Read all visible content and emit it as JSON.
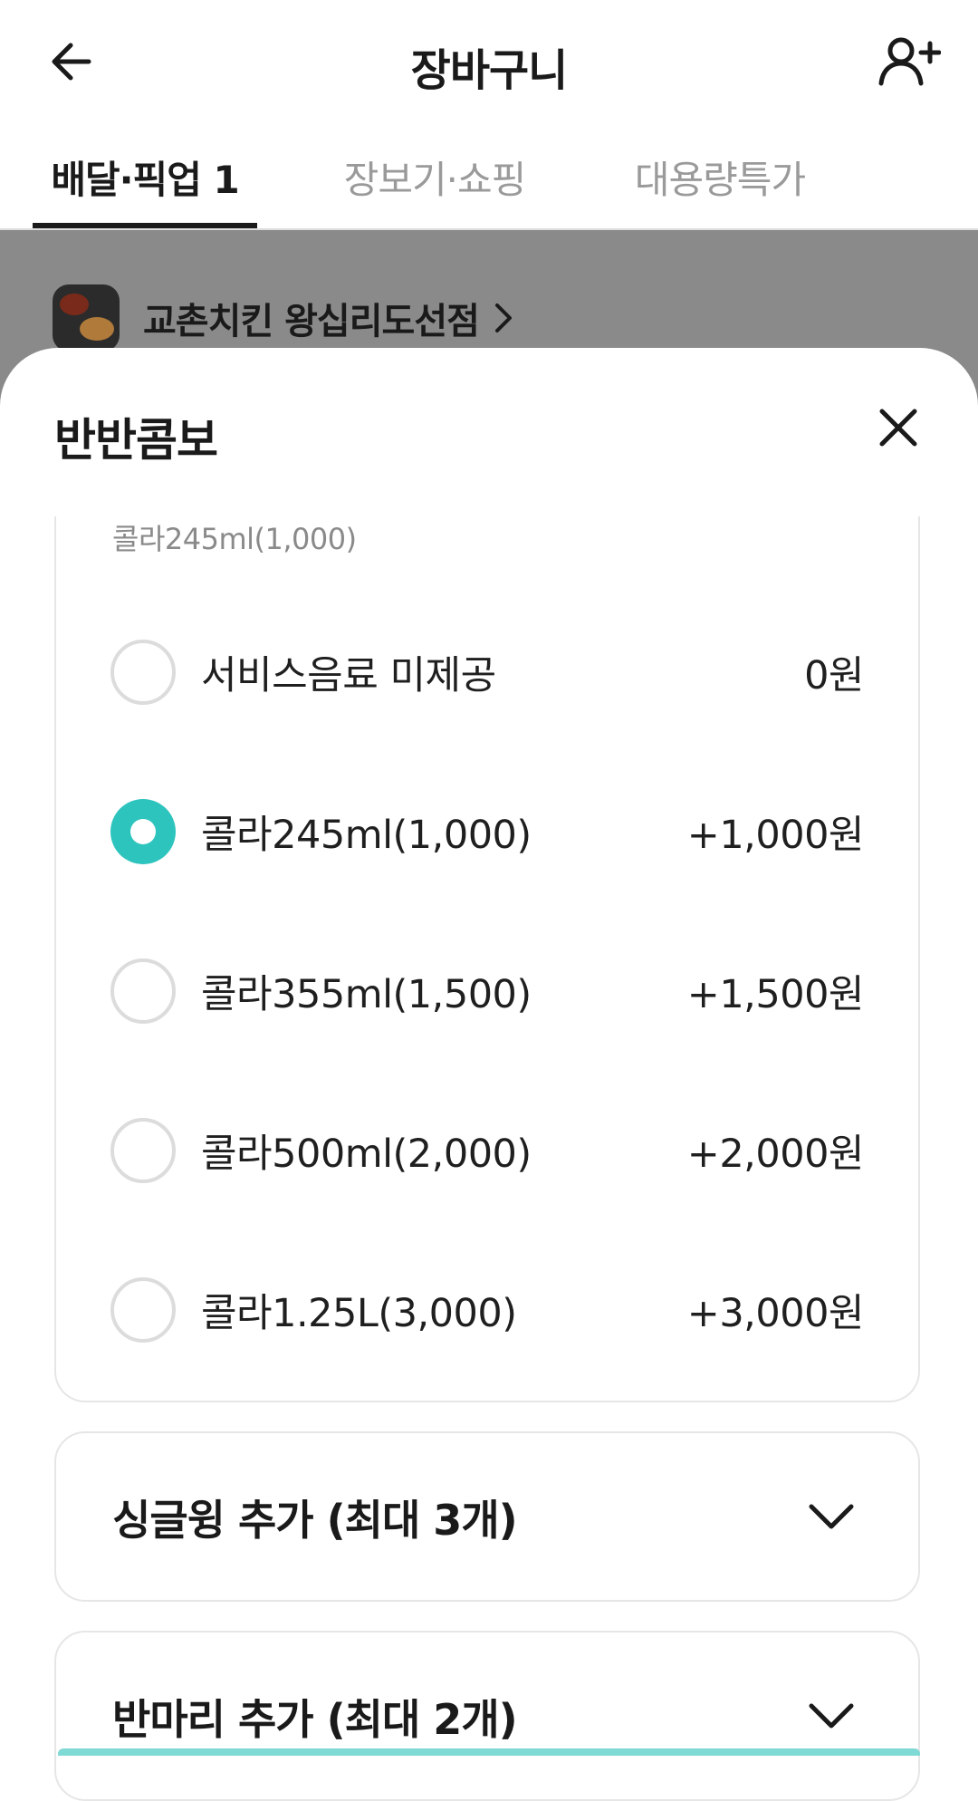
{
  "header": {
    "title": "장바구니",
    "back_icon": "arrow-left-icon",
    "invite_icon": "person-add-icon"
  },
  "tabs": [
    {
      "label": "배달·픽업 1",
      "active": true
    },
    {
      "label": "장보기·쇼핑",
      "active": false
    },
    {
      "label": "대용량특가",
      "active": false
    }
  ],
  "store": {
    "name": "교촌치킨 왕십리도선점",
    "chevron_icon": "chevron-right-icon"
  },
  "sheet": {
    "title": "반반콤보",
    "close_icon": "close-icon",
    "selected_summary": "콜라245ml(1,000)",
    "options": [
      {
        "label": "서비스음료 미제공",
        "price": "0원",
        "selected": false
      },
      {
        "label": "콜라245ml(1,000)",
        "price": "+1,000원",
        "selected": true
      },
      {
        "label": "콜라355ml(1,500)",
        "price": "+1,500원",
        "selected": false
      },
      {
        "label": "콜라500ml(2,000)",
        "price": "+2,000원",
        "selected": false
      },
      {
        "label": "콜라1.25L(3,000)",
        "price": "+3,000원",
        "selected": false
      }
    ],
    "sections": [
      {
        "title": "싱글윙 추가 (최대 3개)",
        "icon": "chevron-down-icon"
      },
      {
        "title": "반마리 추가 (최대 2개)",
        "icon": "chevron-down-icon"
      }
    ]
  },
  "colors": {
    "accent": "#2ec4be",
    "dim_overlay": "#8a8a8a",
    "text_primary": "#1a1a1a",
    "text_muted": "#9a9a9a"
  }
}
